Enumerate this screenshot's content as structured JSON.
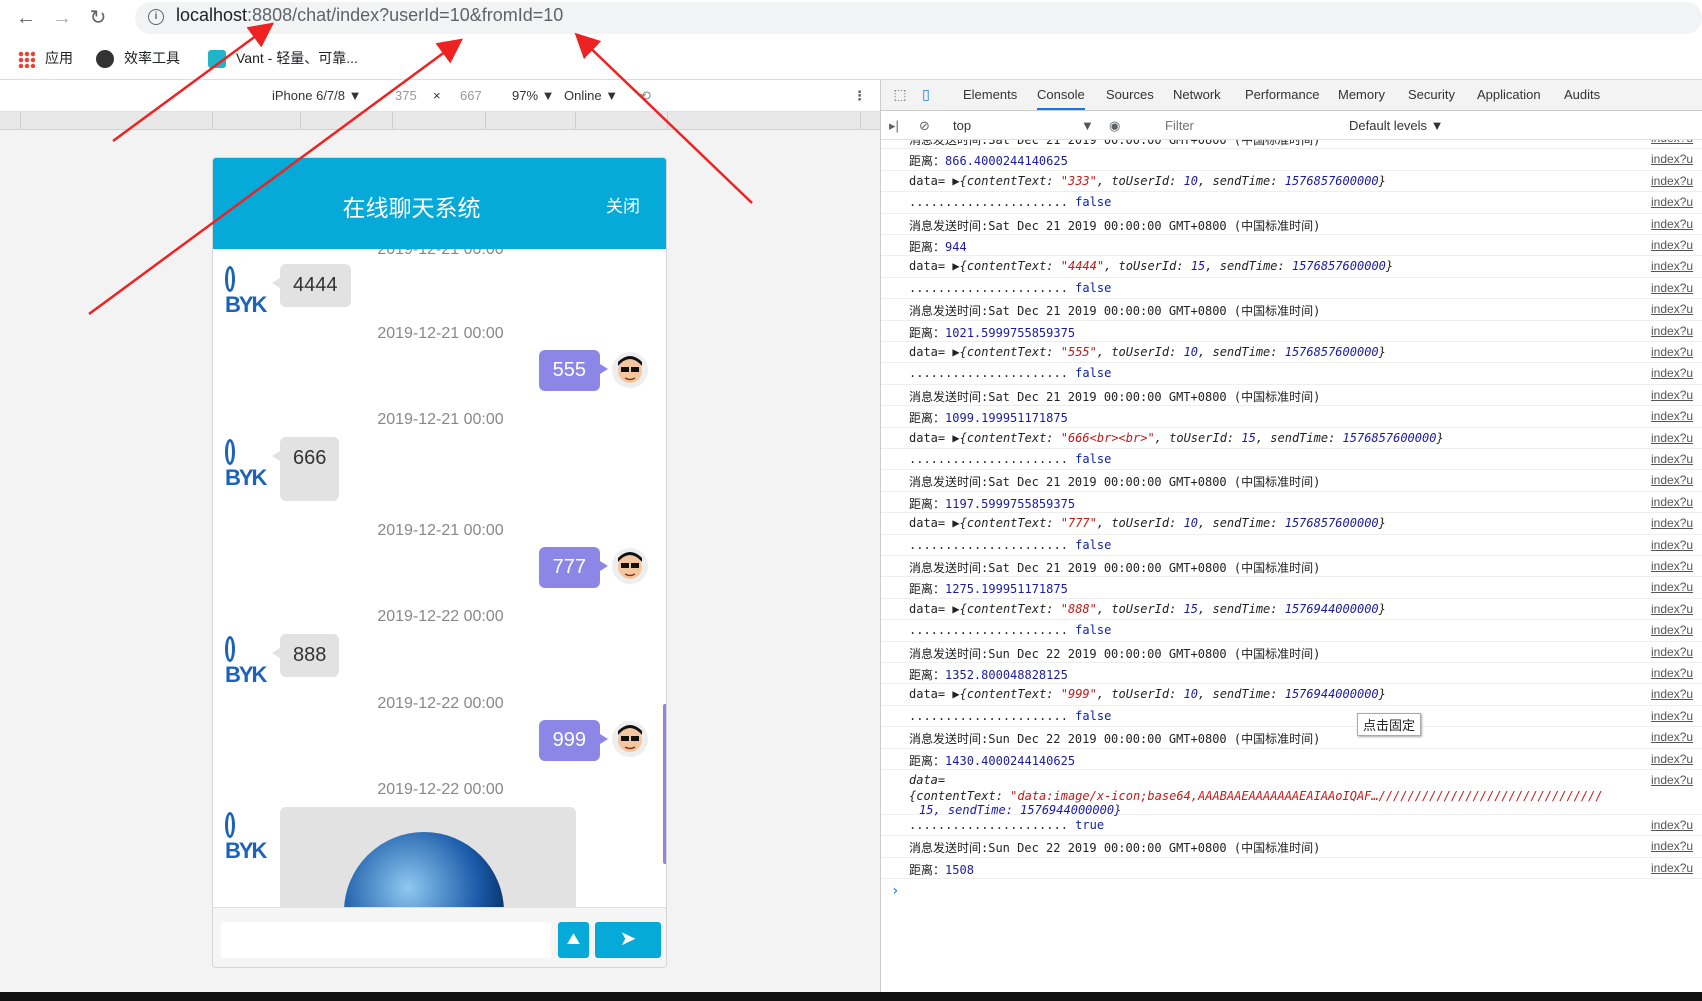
{
  "browser": {
    "back_icon": "arrow-left-icon",
    "forward_icon": "arrow-right-icon",
    "reload_icon": "reload-icon",
    "url_host": "localhost",
    "url_rest": ":8808/chat/index?userId=10&fromId=10",
    "bookmarks": [
      "应用",
      "效率工具",
      "Vant - 轻量、可靠..."
    ]
  },
  "emulator": {
    "device": "iPhone 6/7/8 ▼",
    "width": "375",
    "x": "×",
    "height": "667",
    "zoom": "97% ▼",
    "network": "Online ▼"
  },
  "chat": {
    "title": "在线聊天系统",
    "close": "关闭",
    "messages": [
      {
        "time": "2019-12-21 00:00",
        "side": "left",
        "text": "4444"
      },
      {
        "time": "2019-12-21 00:00",
        "side": "right",
        "text": "555"
      },
      {
        "time": "2019-12-21 00:00",
        "side": "left",
        "text": "666"
      },
      {
        "time": "2019-12-21 00:00",
        "side": "right",
        "text": "777"
      },
      {
        "time": "2019-12-22 00:00",
        "side": "left",
        "text": "888"
      },
      {
        "time": "2019-12-22 00:00",
        "side": "right",
        "text": "999"
      },
      {
        "time": "2019-12-22 00:00",
        "side": "left",
        "text": ""
      }
    ],
    "send_label": "➤",
    "image_label": "⛰"
  },
  "devtools": {
    "tabs": [
      "Elements",
      "Console",
      "Sources",
      "Network",
      "Performance",
      "Memory",
      "Security",
      "Application",
      "Audits"
    ],
    "context": "top",
    "filter_placeholder": "Filter",
    "levels": "Default levels ▼",
    "src": "index?u",
    "tooltip": "点击固定",
    "lines": [
      {
        "type": "text",
        "text": "消息发送时间:Sat Dec 21 2019 00:00:00 GMT+0800 (中国标准时间)"
      },
      {
        "type": "dist",
        "label": "距离：",
        "value": "866.4000244140625"
      },
      {
        "type": "data",
        "content": "\"333\"",
        "toUserId": "10",
        "sendTime": "1576857600000"
      },
      {
        "type": "bool",
        "dots": "......................",
        "value": "false"
      },
      {
        "type": "text",
        "text": "消息发送时间:Sat Dec 21 2019 00:00:00 GMT+0800 (中国标准时间)"
      },
      {
        "type": "dist",
        "label": "距离：",
        "value": "944"
      },
      {
        "type": "data",
        "content": "\"4444\"",
        "toUserId": "15",
        "sendTime": "1576857600000"
      },
      {
        "type": "bool",
        "dots": "......................",
        "value": "false"
      },
      {
        "type": "text",
        "text": "消息发送时间:Sat Dec 21 2019 00:00:00 GMT+0800 (中国标准时间)"
      },
      {
        "type": "dist",
        "label": "距离：",
        "value": "1021.5999755859375"
      },
      {
        "type": "data",
        "content": "\"555\"",
        "toUserId": "10",
        "sendTime": "1576857600000"
      },
      {
        "type": "bool",
        "dots": "......................",
        "value": "false"
      },
      {
        "type": "text",
        "text": "消息发送时间:Sat Dec 21 2019 00:00:00 GMT+0800 (中国标准时间)"
      },
      {
        "type": "dist",
        "label": "距离：",
        "value": "1099.199951171875"
      },
      {
        "type": "data",
        "content": "\"666<br><br>\"",
        "toUserId": "15",
        "sendTime": "1576857600000"
      },
      {
        "type": "bool",
        "dots": "......................",
        "value": "false"
      },
      {
        "type": "text",
        "text": "消息发送时间:Sat Dec 21 2019 00:00:00 GMT+0800 (中国标准时间)"
      },
      {
        "type": "dist",
        "label": "距离：",
        "value": "1197.5999755859375"
      },
      {
        "type": "data",
        "content": "\"777\"",
        "toUserId": "10",
        "sendTime": "1576857600000"
      },
      {
        "type": "bool",
        "dots": "......................",
        "value": "false"
      },
      {
        "type": "text",
        "text": "消息发送时间:Sat Dec 21 2019 00:00:00 GMT+0800 (中国标准时间)"
      },
      {
        "type": "dist",
        "label": "距离：",
        "value": "1275.199951171875"
      },
      {
        "type": "data",
        "content": "\"888\"",
        "toUserId": "15",
        "sendTime": "1576944000000"
      },
      {
        "type": "bool",
        "dots": "......................",
        "value": "false"
      },
      {
        "type": "text",
        "text": "消息发送时间:Sun Dec 22 2019 00:00:00 GMT+0800 (中国标准时间)"
      },
      {
        "type": "dist",
        "label": "距离：",
        "value": "1352.800048828125"
      },
      {
        "type": "data",
        "content": "\"999\"",
        "toUserId": "10",
        "sendTime": "1576944000000"
      },
      {
        "type": "bool",
        "dots": "......................",
        "value": "false"
      },
      {
        "type": "text",
        "text": "消息发送时间:Sun Dec 22 2019 00:00:00 GMT+0800 (中国标准时间)"
      },
      {
        "type": "dist",
        "label": "距离：",
        "value": "1430.4000244140625"
      },
      {
        "type": "bigdata",
        "label": "data=",
        "content": "\"data:image/x-icon;base64,AAABAAEAAAAAAAEAIAAoIQAF…///////////////////////////////",
        "cont": "15, sendTime: 1576944000000}"
      },
      {
        "type": "bool",
        "dots": "......................",
        "value": "true"
      },
      {
        "type": "text",
        "text": "消息发送时间:Sun Dec 22 2019 00:00:00 GMT+0800 (中国标准时间)"
      },
      {
        "type": "dist",
        "label": "距离：",
        "value": "1508"
      }
    ],
    "prompt": "›"
  },
  "colors": {
    "chat_header": "#06aad8",
    "bubble_right": "#8c87e6",
    "bubble_left": "#e2e2e2",
    "arrow": "#ee2222"
  }
}
